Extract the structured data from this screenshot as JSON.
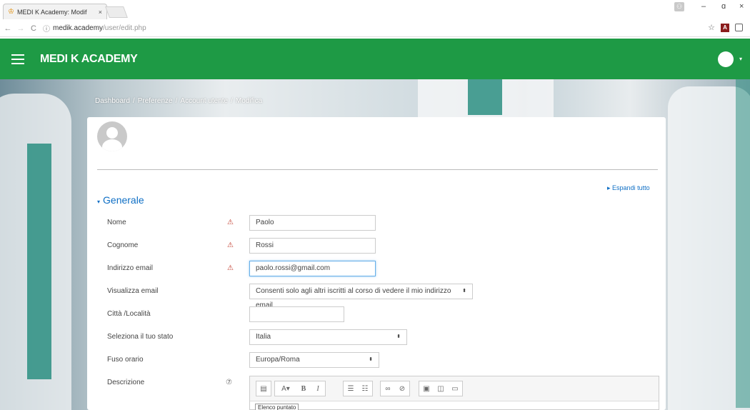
{
  "browser": {
    "tab_title": "MEDI K Academy: Modif",
    "tab_close": "×",
    "url_host": "medik.academy",
    "url_path": "/user/edit.php",
    "back": "←",
    "forward": "→",
    "reload": "C",
    "info": "ⓘ",
    "star": "☆",
    "minimize": "–",
    "restore": "ɑ",
    "close": "×"
  },
  "header": {
    "brand": "MEDI K ACADEMY",
    "caret": "▾"
  },
  "breadcrumb": [
    "Dashboard",
    "Preferenze",
    "Account utente",
    "Modifica"
  ],
  "breadcrumb_sep": "/",
  "card": {
    "expand_all": "Espandi tutto",
    "expand_arrow": "▸",
    "section_arrow": "▾",
    "section_title": "Generale",
    "required_mark": "⚠",
    "help_mark": "⑦"
  },
  "fields": {
    "nome": {
      "label": "Nome",
      "value": "Paolo"
    },
    "cognome": {
      "label": "Cognome",
      "value": "Rossi"
    },
    "email": {
      "label": "Indirizzo email",
      "value": "paolo.rossi@gmail.com"
    },
    "visualizza": {
      "label": "Visualizza email",
      "value": "Consenti solo agli altri iscritti al corso di vedere il mio indirizzo email"
    },
    "citta": {
      "label": "Città /Località",
      "value": ""
    },
    "stato": {
      "label": "Seleziona il tuo stato",
      "value": "Italia"
    },
    "fuso": {
      "label": "Fuso orario",
      "value": "Europa/Roma"
    },
    "descrizione": {
      "label": "Descrizione"
    }
  },
  "select_arrow": "⬍",
  "editor": {
    "tooltip": "Elenco puntato"
  },
  "colors": {
    "header_green": "#1e9a45",
    "link_blue": "#0f6fc5",
    "required_red": "#c0392b"
  }
}
